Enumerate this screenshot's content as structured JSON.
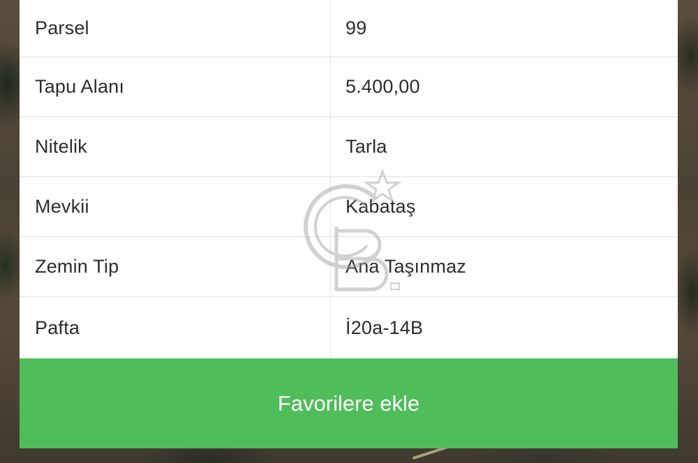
{
  "property_details": {
    "rows": [
      {
        "label": "Parsel",
        "value": "99"
      },
      {
        "label": "Tapu Alanı",
        "value": "5.400,00"
      },
      {
        "label": "Nitelik",
        "value": "Tarla"
      },
      {
        "label": "Mevkii",
        "value": "Kabataş"
      },
      {
        "label": "Zemin Tip",
        "value": "Ana Taşınmaz"
      },
      {
        "label": "Pafta",
        "value": "İ20a-14B"
      }
    ]
  },
  "actions": {
    "favorite_label": "Favorilere ekle"
  },
  "colors": {
    "button_green": "#50bd5b",
    "panel_background": "#ffffff",
    "text": "#2c2c2c"
  },
  "icons": {
    "watermark": "cb-star-logo-watermark"
  }
}
